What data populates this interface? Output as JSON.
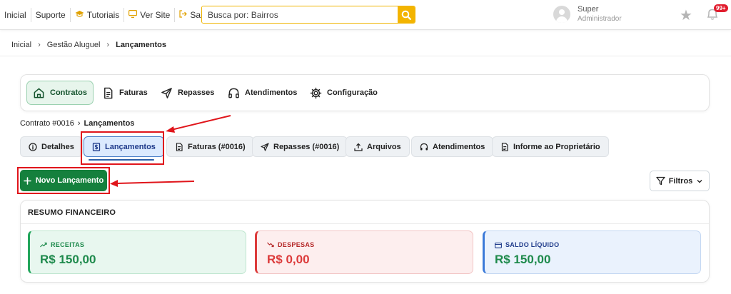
{
  "topnav": {
    "items": [
      {
        "label": "Inicial"
      },
      {
        "label": "Suporte"
      },
      {
        "label": "Tutoriais",
        "icon": "graduation-cap-icon"
      },
      {
        "label": "Ver Site",
        "icon": "monitor-icon"
      },
      {
        "label": "Sair",
        "icon": "logout-icon"
      }
    ],
    "search_placeholder": "Busca por: Bairros"
  },
  "user": {
    "name": "Super",
    "role": "Administrador",
    "notifications": "99+"
  },
  "breadcrumb": {
    "items": [
      "Inicial",
      "Gestão Aluguel",
      "Lançamentos"
    ]
  },
  "modules": {
    "tabs": [
      {
        "label": "Contratos",
        "icon": "home-icon",
        "active": true
      },
      {
        "label": "Faturas",
        "icon": "document-icon"
      },
      {
        "label": "Repasses",
        "icon": "send-icon"
      },
      {
        "label": "Atendimentos",
        "icon": "headphones-icon"
      },
      {
        "label": "Configuração",
        "icon": "gear-icon"
      }
    ]
  },
  "contract": {
    "number": "Contrato #0016",
    "section": "Lançamentos"
  },
  "subtabs": [
    {
      "label": "Detalhes",
      "icon": "info-icon"
    },
    {
      "label": "Lançamentos",
      "icon": "receipt-icon",
      "active": true
    },
    {
      "label": "Faturas (#0016)",
      "icon": "document-icon"
    },
    {
      "label": "Repasses (#0016)",
      "icon": "send-icon"
    },
    {
      "label": "Arquivos",
      "icon": "upload-icon"
    },
    {
      "label": "Atendimentos",
      "icon": "headphones-icon"
    },
    {
      "label": "Informe ao Proprietário",
      "icon": "document-icon"
    }
  ],
  "actions": {
    "new_label": "Novo Lançamento",
    "filter_label": "Filtros"
  },
  "summary": {
    "title": "RESUMO FINANCEIRO",
    "cards": [
      {
        "label": "RECEITAS",
        "value": "R$ 150,00",
        "color": "#22a55b"
      },
      {
        "label": "DESPESAS",
        "value": "R$ 0,00",
        "color": "#dc3a3a"
      },
      {
        "label": "SALDO LÍQUIDO",
        "value": "R$ 150,00",
        "color": "#3b7ad9"
      }
    ]
  },
  "colors": {
    "accent": "#15803d",
    "search_accent": "#f3b400",
    "annotation": "#e0151b"
  }
}
